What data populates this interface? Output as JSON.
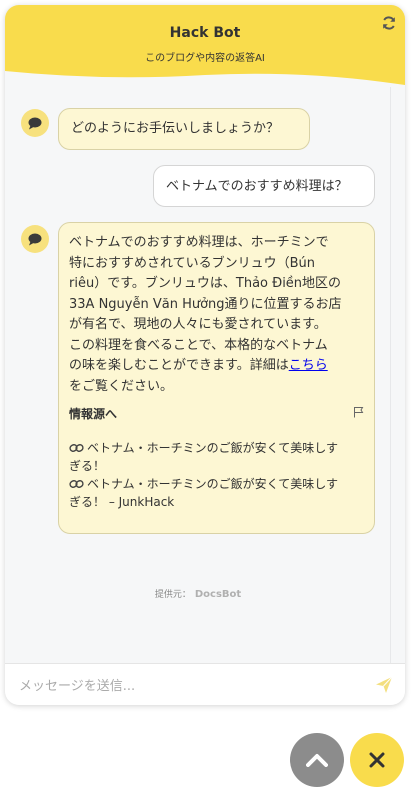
{
  "header": {
    "title": "Hack Bot",
    "subtitle": "このブログや内容の返答AI"
  },
  "messages": [
    {
      "role": "bot",
      "text": "どのようにお手伝いしましょうか？"
    },
    {
      "role": "user",
      "text": "ベトナムでのおすすめ料理は？"
    },
    {
      "role": "bot",
      "lines": [
        "ベトナムでのおすすめ料理は、ホーチミンで",
        "特におすすめされているブンリュウ（Bún",
        "riêu）です。ブンリュウは、Thảo Điền地区の",
        "33A Nguyễn Văn Hưởng通りに位置するお店",
        "が有名で、現地の人々にも愛されています。",
        "この料理を食べることで、本格的なベトナム",
        "の味を楽しむことができます。詳細は"
      ],
      "link_text": "こちら",
      "after_link": "をご覧ください。",
      "sources_title": "情報源へ",
      "sources": [
        {
          "line1": "ベトナム・ホーチミンのご飯が安くて美味しす",
          "line2": "ぎる！"
        },
        {
          "line1": "ベトナム・ホーチミンのご飯が安くて美味しす",
          "line2": "ぎる！ – JunkHack"
        }
      ]
    }
  ],
  "footer": {
    "powered_by": "提供元：",
    "brand": "DocsBot"
  },
  "input": {
    "placeholder": "メッセージを送信..."
  },
  "colors": {
    "header_yellow": "#f9dc4c",
    "bot_bubble": "#fdf7d3",
    "fab_gray": "#8c8c8c",
    "fab_yellow": "#f9dc4c"
  },
  "icons": [
    "refresh-icon",
    "chat-bubble-icon",
    "flag-icon",
    "link-icon",
    "send-icon",
    "chevron-up-icon",
    "close-icon"
  ]
}
